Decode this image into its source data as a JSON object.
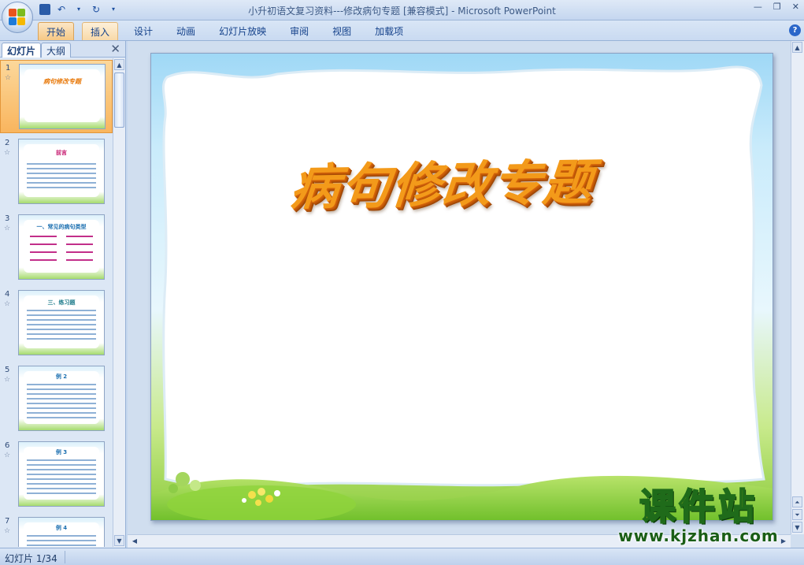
{
  "window": {
    "title": "小升初语文复习资料---修改病句专题 [兼容模式] - Microsoft PowerPoint",
    "controls": [
      "—",
      "❐",
      "✕"
    ]
  },
  "quick_access": {
    "save_icon": "save-icon",
    "undo_icon": "undo-icon",
    "redo_icon": "redo-icon"
  },
  "ribbon": {
    "tabs": [
      {
        "label": "开始",
        "state": "active"
      },
      {
        "label": "插入",
        "state": "highlighted"
      },
      {
        "label": "设计",
        "state": "normal"
      },
      {
        "label": "动画",
        "state": "normal"
      },
      {
        "label": "幻灯片放映",
        "state": "normal"
      },
      {
        "label": "审阅",
        "state": "normal"
      },
      {
        "label": "视图",
        "state": "normal"
      },
      {
        "label": "加载项",
        "state": "normal"
      }
    ],
    "help_label": "?"
  },
  "left_panel": {
    "tabs": [
      "幻灯片",
      "大纲"
    ],
    "close_label": "✕",
    "thumbnails": [
      {
        "number": "1",
        "title": "病句修改专题",
        "selected": true
      },
      {
        "number": "2",
        "title": "前言",
        "selected": false
      },
      {
        "number": "3",
        "title": "一、常见的病句类型",
        "selected": false
      },
      {
        "number": "4",
        "title": "三、练习题",
        "selected": false
      },
      {
        "number": "5",
        "title": "例 2",
        "selected": false
      },
      {
        "number": "6",
        "title": "例 3",
        "selected": false
      },
      {
        "number": "7",
        "title": "例 4",
        "selected": false
      }
    ],
    "star_glyph": "☆"
  },
  "slide": {
    "title": "病句修改专题"
  },
  "watermark": {
    "chinese": "课件站",
    "url": "www.kjzhan.com"
  },
  "status": {
    "slide_counter": "幻灯片 1/34"
  },
  "colors": {
    "title_orange": "#f39a1a",
    "ribbon_blue": "#c9daf1",
    "active_tab": "#f6c884",
    "watermark_yellow": "#ffdd00",
    "watermark_green": "#1f6b1a"
  }
}
